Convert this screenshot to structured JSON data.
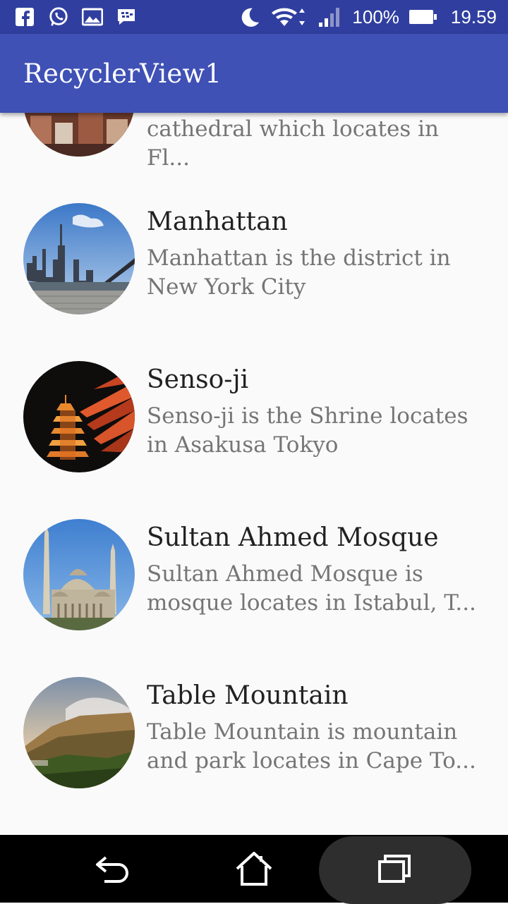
{
  "status_bar": {
    "icons_left": [
      "facebook-icon",
      "whatsapp-icon",
      "gallery-icon",
      "bbm-icon"
    ],
    "icons_right": [
      "moon-icon",
      "wifi-icon",
      "signal-icon"
    ],
    "battery_text": "100%",
    "time": "19.59",
    "bg_color": "#303f9f"
  },
  "app_bar": {
    "title": "RecyclerView1",
    "bg_color": "#3f51b5"
  },
  "list": {
    "items": [
      {
        "title": "",
        "description": "cathedral which locates in Fl..."
      },
      {
        "title": "Manhattan",
        "description": "Manhattan is the district in\nNew York City"
      },
      {
        "title": "Senso-ji",
        "description": "Senso-ji is the Shrine locates\nin Asakusa Tokyo"
      },
      {
        "title": "Sultan Ahmed Mosque",
        "description": "Sultan Ahmed Mosque is\nmosque locates in Istabul, T..."
      },
      {
        "title": "Table Mountain",
        "description": "Table Mountain is mountain\nand park locates in Cape To..."
      }
    ]
  },
  "nav_bar": {
    "buttons": [
      "back-icon",
      "home-icon",
      "recents-icon"
    ]
  }
}
